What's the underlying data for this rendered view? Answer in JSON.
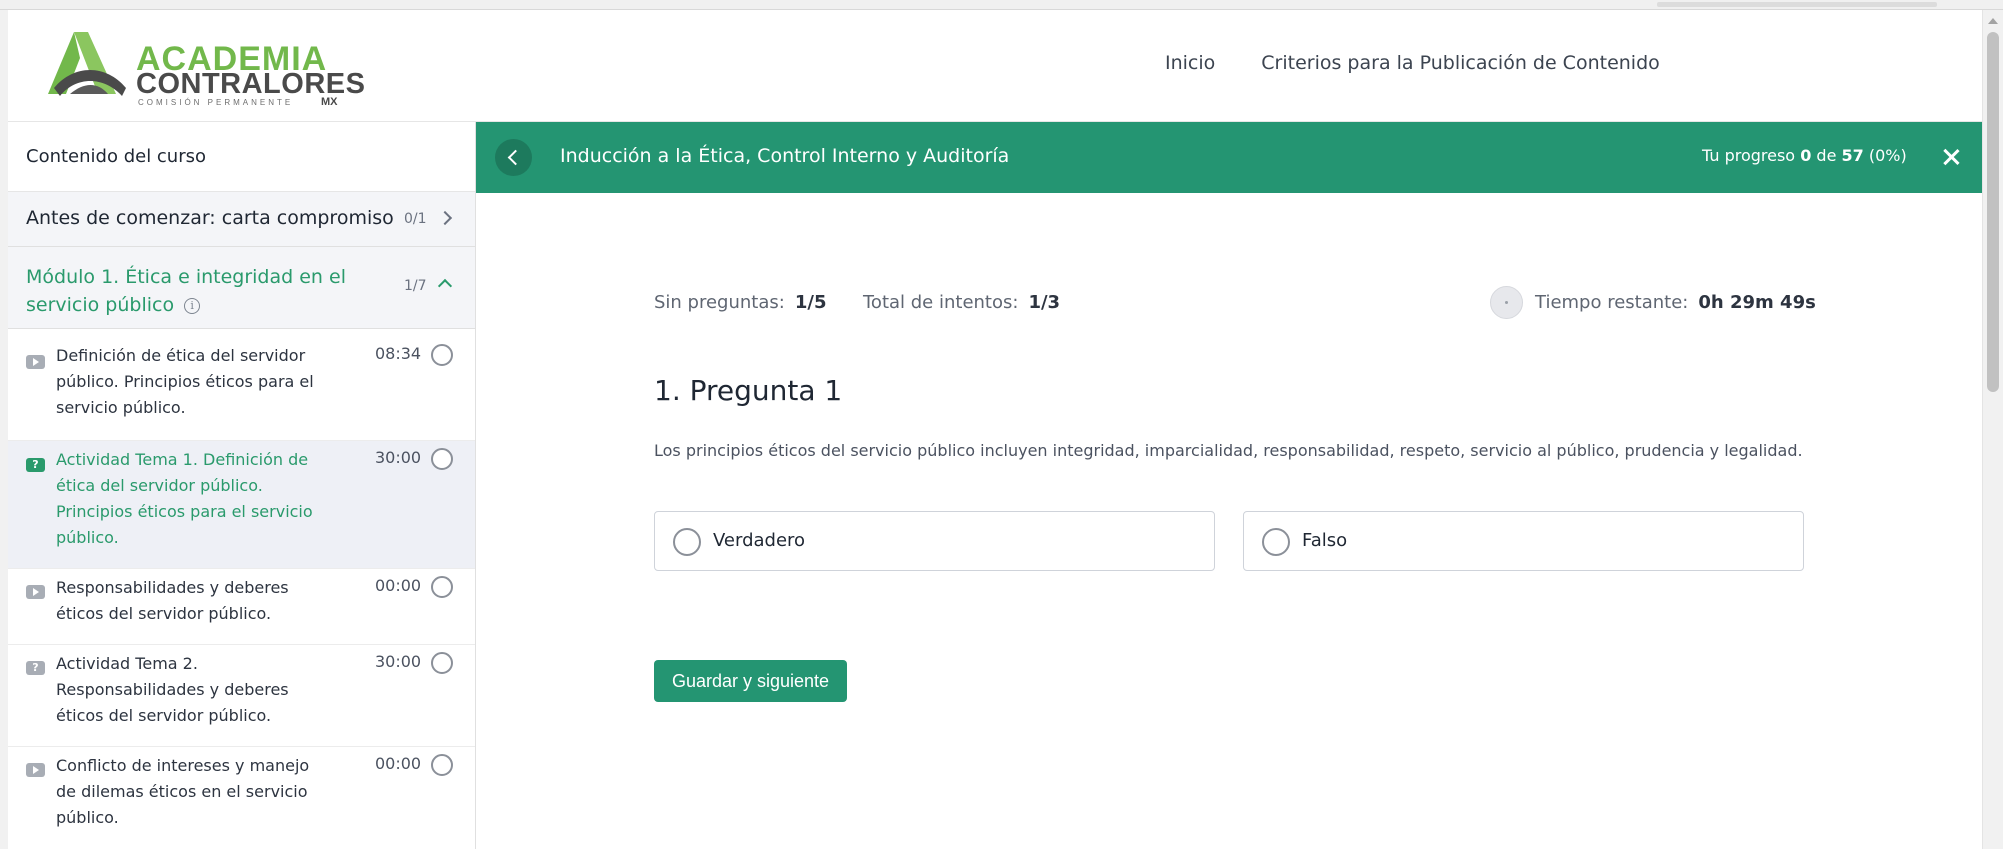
{
  "header": {
    "logo": {
      "line1": "ACADEMIA",
      "line2": "CONTRALORES",
      "line3": "COMISIÓN PERMANENTE",
      "line4": "MX"
    },
    "nav": [
      {
        "label": "Inicio"
      },
      {
        "label": "Criterios para la Publicación de Contenido"
      }
    ]
  },
  "sidebar": {
    "title": "Contenido del curso",
    "sections": [
      {
        "title": "Antes de comenzar: carta compromiso",
        "count": "0/1",
        "expanded": false
      },
      {
        "title": "Módulo 1. Ética e integridad en el servicio público",
        "count": "1/7",
        "expanded": true,
        "info_icon": "i"
      }
    ],
    "lessons": [
      {
        "type": "video",
        "title": "Definición de ética del servidor público. Principios éticos para el servicio público.",
        "time": "08:34",
        "active": false
      },
      {
        "type": "quiz",
        "icon_char": "?",
        "title": "Actividad Tema 1. Definición de ética del servidor público. Principios éticos para el servicio público.",
        "time": "30:00",
        "active": true
      },
      {
        "type": "video",
        "title": "Responsabilidades y deberes éticos del servidor público.",
        "time": "00:00",
        "active": false
      },
      {
        "type": "quiz",
        "icon_char": "?",
        "title": "Actividad Tema 2. Responsabilidades y deberes éticos del servidor público.",
        "time": "30:00",
        "active": false
      },
      {
        "type": "video",
        "title": "Conflicto de intereses y manejo de dilemas éticos en el servicio público.",
        "time": "00:00",
        "active": false
      }
    ]
  },
  "banner": {
    "title": "Inducción a la Ética, Control Interno y Auditoría",
    "progress_prefix": "Tu progreso",
    "progress_done": "0",
    "progress_of": "de",
    "progress_total": "57",
    "progress_pct": "(0%)"
  },
  "quiz": {
    "questions_label": "Sin preguntas:",
    "questions_value": "1/5",
    "attempts_label": "Total de intentos:",
    "attempts_value": "1/3",
    "time_label": "Tiempo restante:",
    "time_value": "0h 29m 49s",
    "question_title": "1. Pregunta 1",
    "question_text": "Los principios éticos del servicio público incluyen integridad, imparcialidad, responsabilidad, respeto, servicio al público, prudencia y legalidad.",
    "options": [
      {
        "label": "Verdadero"
      },
      {
        "label": "Falso"
      }
    ],
    "save_label": "Guardar y siguiente"
  },
  "colors": {
    "primary": "#249572",
    "accent_green": "#2a9a6c",
    "logo_green": "#72b84b"
  }
}
